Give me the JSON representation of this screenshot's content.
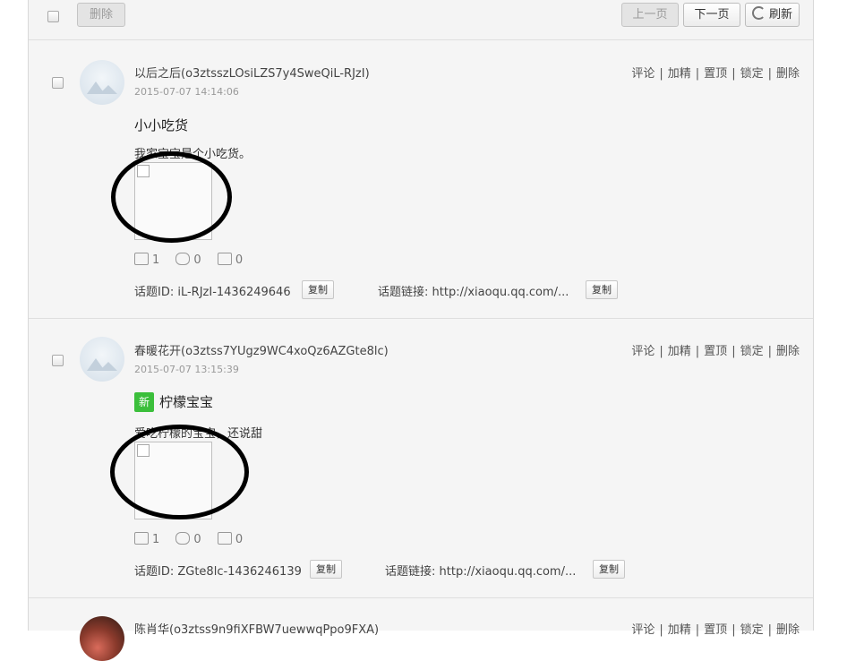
{
  "toolbar": {
    "delete_label": "删除",
    "prev_label": "上一页",
    "next_label": "下一页",
    "refresh_label": "刷新"
  },
  "action_labels": [
    "评论",
    "加精",
    "置顶",
    "锁定",
    "删除"
  ],
  "copy_label": "复制",
  "topic_id_prefix": "话题ID: ",
  "topic_link_prefix": "话题链接: ",
  "posts": [
    {
      "username": "以后之后(o3ztsszLOsiLZS7y4SweQiL-RJzI)",
      "time": "2015-07-07 14:14:06",
      "is_new": false,
      "title": "小小吃货",
      "content": "我家宝宝是个小吃货。",
      "likes": "1",
      "comments": "0",
      "shares": "0",
      "topic_id": "iL-RJzI-1436249646",
      "topic_link": "http://xiaoqu.qq.com/..."
    },
    {
      "username": "春暖花开(o3ztss7YUgz9WC4xoQz6AZGte8lc)",
      "time": "2015-07-07 13:15:39",
      "is_new": true,
      "new_badge": "新",
      "title": "柠檬宝宝",
      "content": "爱吃柠檬的宝宝，还说甜",
      "likes": "1",
      "comments": "0",
      "shares": "0",
      "topic_id": "ZGte8lc-1436246139",
      "topic_link": "http://xiaoqu.qq.com/..."
    },
    {
      "username": "陈肖华(o3ztss9n9fiXFBW7uewwqPpo9FXA)"
    }
  ]
}
